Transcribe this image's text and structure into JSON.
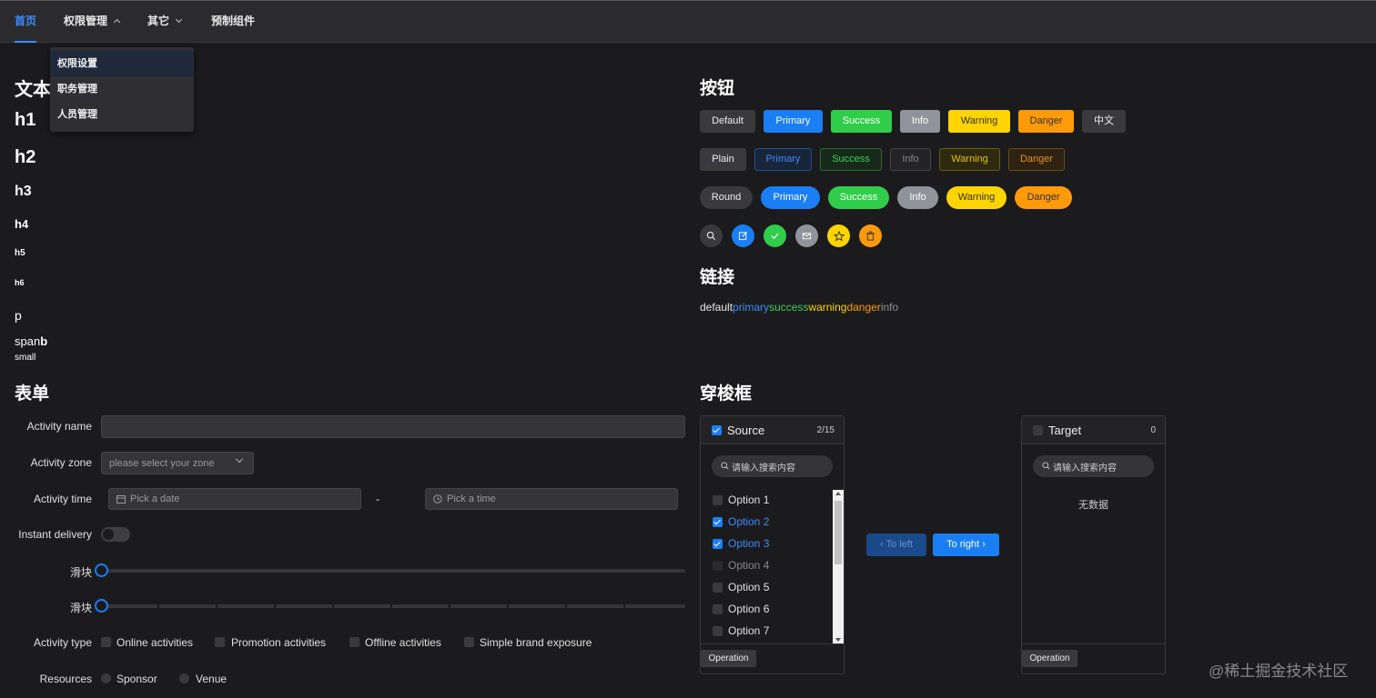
{
  "nav": {
    "items": [
      {
        "label": "首页"
      },
      {
        "label": "权限管理"
      },
      {
        "label": "其它"
      },
      {
        "label": "预制组件"
      }
    ],
    "dropdown": [
      "权限设置",
      "职务管理",
      "人员管理"
    ]
  },
  "text_section": {
    "title": "文本",
    "h1": "h1",
    "h2": "h2",
    "h3": "h3",
    "h4": "h4",
    "h5": "h5",
    "h6": "h6",
    "p": "p",
    "span": "span",
    "b": "b",
    "small": "small"
  },
  "buttons_section": {
    "title": "按钮",
    "row1": [
      "Default",
      "Primary",
      "Success",
      "Info",
      "Warning",
      "Danger",
      "中文"
    ],
    "row2": [
      "Plain",
      "Primary",
      "Success",
      "Info",
      "Warning",
      "Danger"
    ],
    "row3": [
      "Round",
      "Primary",
      "Success",
      "Info",
      "Warning",
      "Danger"
    ],
    "icons": [
      "search-icon",
      "edit-icon",
      "check-icon",
      "message-icon",
      "star-icon",
      "delete-icon"
    ],
    "colors": {
      "primary": "#1a7ef5",
      "success": "#2fcd4a",
      "info": "#909399",
      "warning": "#ffd400",
      "danger": "#ff9a0a"
    }
  },
  "links_section": {
    "title": "链接",
    "links": [
      "default",
      "primary",
      "success",
      "warning",
      "danger",
      "info"
    ]
  },
  "form_section": {
    "title": "表单",
    "name_label": "Activity name",
    "name_value": "",
    "zone_label": "Activity zone",
    "zone_placeholder": "please select your zone",
    "time_label": "Activity time",
    "date_placeholder": "Pick a date",
    "time_separator": "-",
    "time_placeholder": "Pick a time",
    "delivery_label": "Instant delivery",
    "delivery_on": false,
    "slider_label": "滑块",
    "slider1_value": 0,
    "slider2_value": 0,
    "type_label": "Activity type",
    "types": [
      "Online activities",
      "Promotion activities",
      "Offline activities",
      "Simple brand exposure"
    ],
    "resources_label": "Resources",
    "resources": [
      "Sponsor",
      "Venue"
    ]
  },
  "transfer_section": {
    "title": "穿梭框",
    "source": {
      "title": "Source",
      "count": "2/15",
      "search_placeholder": "请输入搜索内容",
      "options": [
        {
          "label": "Option 1",
          "checked": false,
          "disabled": false
        },
        {
          "label": "Option 2",
          "checked": true,
          "disabled": false
        },
        {
          "label": "Option 3",
          "checked": true,
          "disabled": false
        },
        {
          "label": "Option 4",
          "checked": false,
          "disabled": true
        },
        {
          "label": "Option 5",
          "checked": false,
          "disabled": false
        },
        {
          "label": "Option 6",
          "checked": false,
          "disabled": false
        },
        {
          "label": "Option 7",
          "checked": false,
          "disabled": false
        }
      ],
      "footer_button": "Operation"
    },
    "to_left": "To left",
    "to_right": "To right",
    "target": {
      "title": "Target",
      "count": "0",
      "search_placeholder": "请输入搜索内容",
      "empty_text": "无数据",
      "footer_button": "Operation"
    }
  },
  "watermark": "@稀土掘金技术社区"
}
